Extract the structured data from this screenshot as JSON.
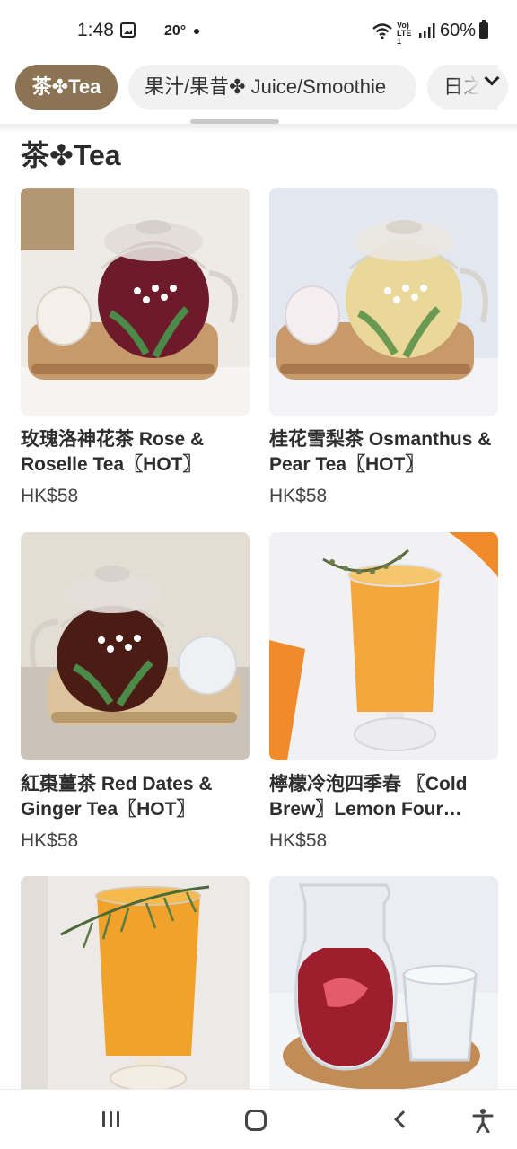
{
  "status_bar": {
    "time": "1:48",
    "temperature": "20°",
    "battery": "60%",
    "network": "Vo) LTE1",
    "icons": [
      "gallery-icon",
      "wifi-icon",
      "signal-icon",
      "battery-icon"
    ]
  },
  "tabs": [
    {
      "label": "茶✤Tea",
      "active": true
    },
    {
      "label": "果汁/果昔✤ Juice/Smoothie",
      "active": false
    },
    {
      "label": "日之",
      "active": false
    }
  ],
  "section": {
    "title": "茶✤Tea"
  },
  "products": [
    {
      "name": "玫瑰洛神花茶 Rose & Roselle Tea〖HOT〗",
      "price": "HK$58",
      "image": "teapot-red-tea"
    },
    {
      "name": "桂花雪梨茶 Osmanthus & Pear Tea〖HOT〗",
      "price": "HK$58",
      "image": "teapot-golden-tea"
    },
    {
      "name": "紅棗薑茶 Red Dates & Ginger Tea〖HOT〗",
      "price": "HK$58",
      "image": "teapot-dark-tea"
    },
    {
      "name": "檸檬冷泡四季春 〖Cold Brew〗Lemon Four…",
      "price": "HK$58",
      "image": "iced-lemon-tea-glass"
    },
    {
      "name": "",
      "price": "",
      "image": "orange-tea-rosemary-glass"
    },
    {
      "name": "",
      "price": "",
      "image": "red-tea-carafe"
    }
  ],
  "colors": {
    "accent": "#8b7354",
    "tab_inactive": "#f1f1f1"
  },
  "nav": {
    "icons": [
      "recent-apps-icon",
      "home-icon",
      "back-icon",
      "accessibility-icon"
    ]
  }
}
